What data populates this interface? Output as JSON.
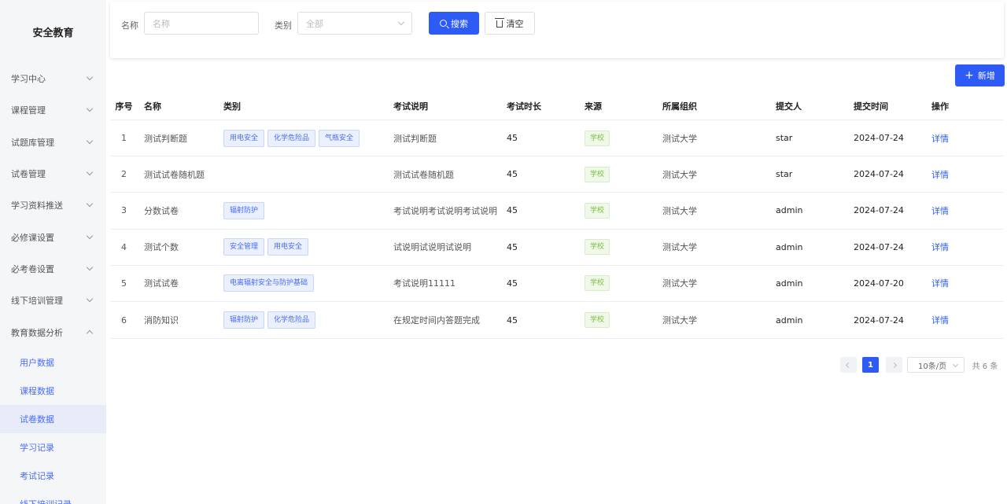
{
  "app": {
    "title": "安全教育"
  },
  "sidebar": {
    "items": [
      {
        "label": "学习中心"
      },
      {
        "label": "课程管理"
      },
      {
        "label": "试题库管理"
      },
      {
        "label": "试卷管理"
      },
      {
        "label": "学习资料推送"
      },
      {
        "label": "必修课设置"
      },
      {
        "label": "必考卷设置"
      },
      {
        "label": "线下培训管理"
      },
      {
        "label": "教育数据分析"
      }
    ],
    "subitems": [
      {
        "label": "用户数据"
      },
      {
        "label": "课程数据"
      },
      {
        "label": "试卷数据"
      },
      {
        "label": "学习记录"
      },
      {
        "label": "考试记录"
      },
      {
        "label": "线下培训记录"
      }
    ],
    "active_subitem": "试卷数据"
  },
  "filter": {
    "name_label": "名称",
    "name_placeholder": "名称",
    "type_label": "类别",
    "type_value": "全部",
    "search_label": "搜索",
    "clear_label": "清空"
  },
  "toolbar": {
    "add_label": "新增",
    "add_icon": "+"
  },
  "table": {
    "headers": [
      "序号",
      "名称",
      "类别",
      "考试说明",
      "考试时长",
      "来源",
      "所属组织",
      "提交人",
      "提交时间",
      "操作"
    ],
    "rows": [
      {
        "idx": "1",
        "name": "测试判断题",
        "tags": [
          "用电安全",
          "化学危险品",
          "气瓶安全"
        ],
        "desc": "测试判断题",
        "duration": "45",
        "source": "学校",
        "org": "测试大学",
        "user": "star",
        "date": "2024-07-24",
        "op": "详情"
      },
      {
        "idx": "2",
        "name": "测试试卷随机题",
        "tags": [],
        "desc": "测试试卷随机题",
        "duration": "45",
        "source": "学校",
        "org": "测试大学",
        "user": "star",
        "date": "2024-07-24",
        "op": "详情"
      },
      {
        "idx": "3",
        "name": "分数试卷",
        "tags": [
          "辐射防护"
        ],
        "desc": "考试说明考试说明考试说明",
        "duration": "45",
        "source": "学校",
        "org": "测试大学",
        "user": "admin",
        "date": "2024-07-24",
        "op": "详情"
      },
      {
        "idx": "4",
        "name": "测试个数",
        "tags": [
          "安全管理",
          "用电安全"
        ],
        "desc": "试说明试说明试说明",
        "duration": "45",
        "source": "学校",
        "org": "测试大学",
        "user": "admin",
        "date": "2024-07-24",
        "op": "详情"
      },
      {
        "idx": "5",
        "name": "测试试卷",
        "tags": [
          "电离辐射安全与防护基础"
        ],
        "desc": "考试说明11111",
        "duration": "45",
        "source": "学校",
        "org": "测试大学",
        "user": "admin",
        "date": "2024-07-20",
        "op": "详情"
      },
      {
        "idx": "6",
        "name": "消防知识",
        "tags": [
          "辐射防护",
          "化学危险品"
        ],
        "desc": "在规定时间内答题完成",
        "duration": "45",
        "source": "学校",
        "org": "测试大学",
        "user": "admin",
        "date": "2024-07-24",
        "op": "详情"
      }
    ]
  },
  "pagination": {
    "current_page": "1",
    "page_size": "10条/页",
    "total_text": "共 6 条"
  },
  "colors": {
    "primary": "#2e5bf5",
    "tag_bg": "#eaf0fd",
    "source_tag": "#7cbd47"
  },
  "icons": {
    "search": "search-icon",
    "clear": "trash-icon",
    "add": "plus-icon"
  }
}
